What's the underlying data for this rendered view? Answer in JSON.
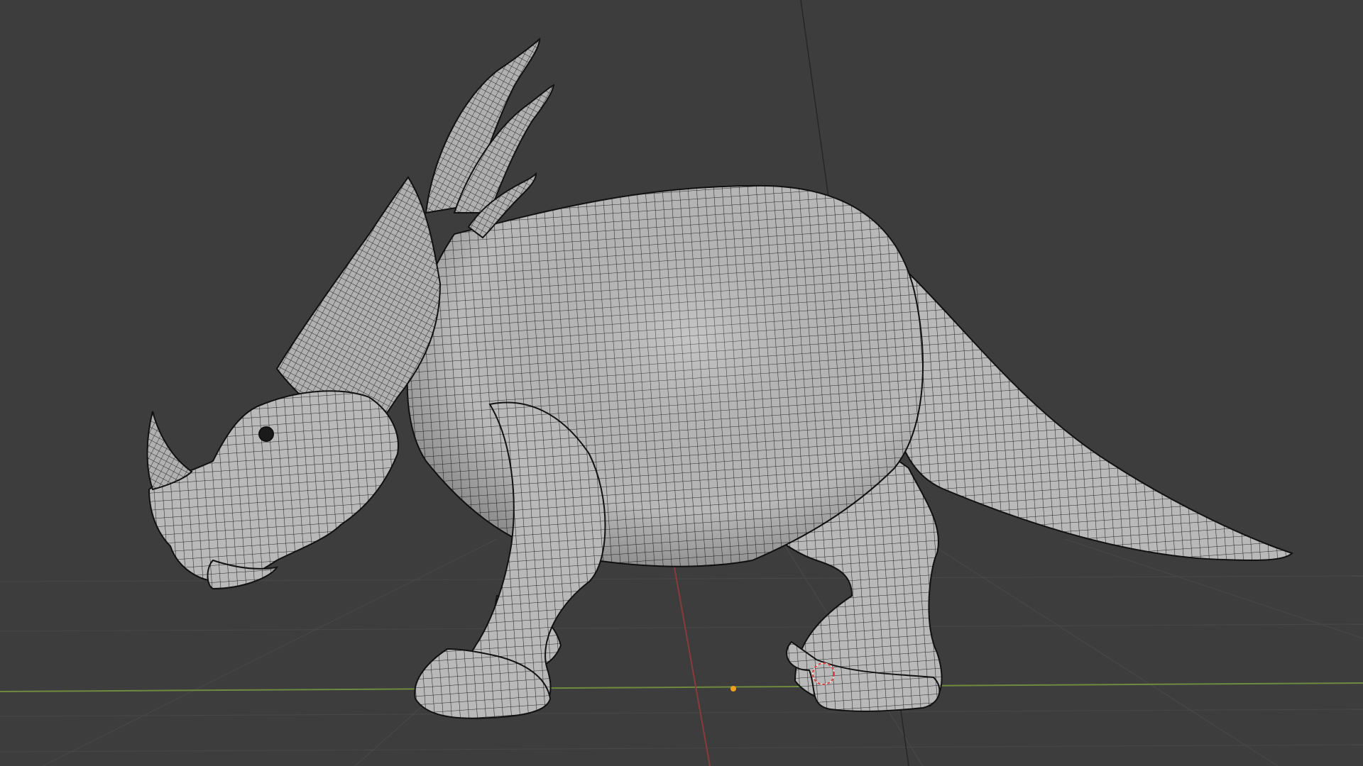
{
  "viewport": {
    "mode": "3D viewport",
    "background_color": "#3d3d3d",
    "grid_line_color": "#4a4a4a",
    "x_axis_color": "#7b3a3a",
    "y_axis_color": "#5a7a3a",
    "z_axis_color": "#2a2a2a",
    "origin_marker_color": "#f0a020",
    "cursor_color": "#cc3333"
  },
  "model": {
    "shading": "solid-wireframe",
    "surface_color": "#b4b4b4",
    "wire_color": "#1e1e1e",
    "icon": "dinosaur-mesh-icon"
  }
}
